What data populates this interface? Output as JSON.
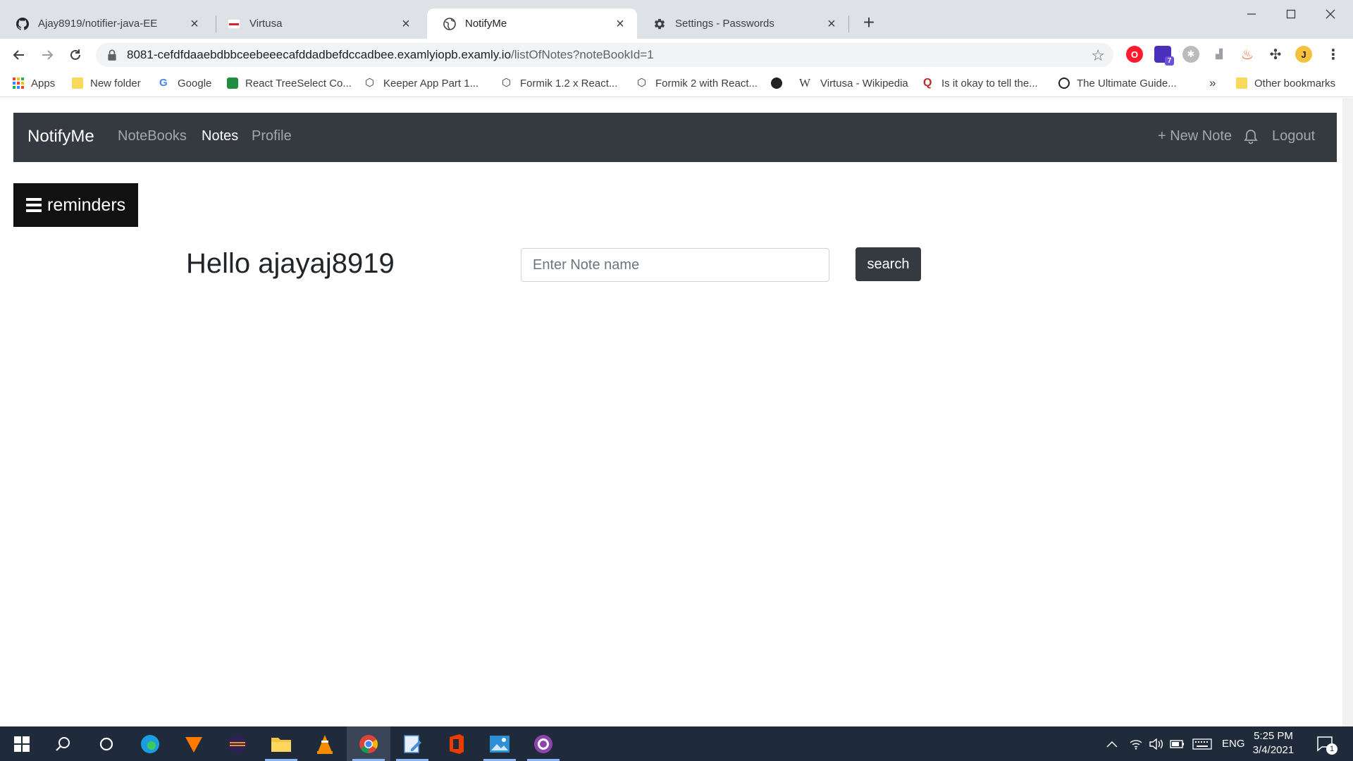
{
  "browser": {
    "tabs": [
      {
        "title": "Ajay8919/notifier-java-EE",
        "icon": "github-icon"
      },
      {
        "title": "Virtusa",
        "icon": "virtusa-icon"
      },
      {
        "title": "NotifyMe",
        "icon": "globe-icon"
      },
      {
        "title": "Settings - Passwords",
        "icon": "gear-icon"
      }
    ],
    "url_host": "8081-cefdfdaaebdbbceebeeecafddadbefdccadbee.examlyiopb.examly.io",
    "url_path": "/listOfNotes?noteBookId=1",
    "bookmarks": [
      {
        "label": "Apps"
      },
      {
        "label": "New folder"
      },
      {
        "label": "Google"
      },
      {
        "label": "React TreeSelect Co..."
      },
      {
        "label": "Keeper App Part 1..."
      },
      {
        "label": "Formik 1.2 x React..."
      },
      {
        "label": "Formik 2 with React..."
      },
      {
        "label": ""
      },
      {
        "label": "Virtusa - Wikipedia"
      },
      {
        "label": "Is it okay to tell the..."
      },
      {
        "label": "The Ultimate Guide..."
      }
    ],
    "more_bookmarks": "»",
    "other_bookmarks": "Other bookmarks",
    "extension_badge": "7"
  },
  "app": {
    "brand": "NotifyMe",
    "nav": {
      "notebooks": "NoteBooks",
      "notes": "Notes",
      "profile": "Profile",
      "new_note": "+ New Note",
      "logout": "Logout"
    },
    "reminders_label": "reminders",
    "greeting": "Hello ajayaj8919",
    "search": {
      "placeholder": "Enter Note name",
      "value": "",
      "button_label": "search"
    }
  },
  "taskbar": {
    "language": "ENG",
    "time": "5:25 PM",
    "date": "3/4/2021",
    "notification_count": "1"
  },
  "colors": {
    "navbar_bg": "#343a40",
    "reminders_bg": "#111111",
    "taskbar_bg": "#1f2a3a"
  }
}
